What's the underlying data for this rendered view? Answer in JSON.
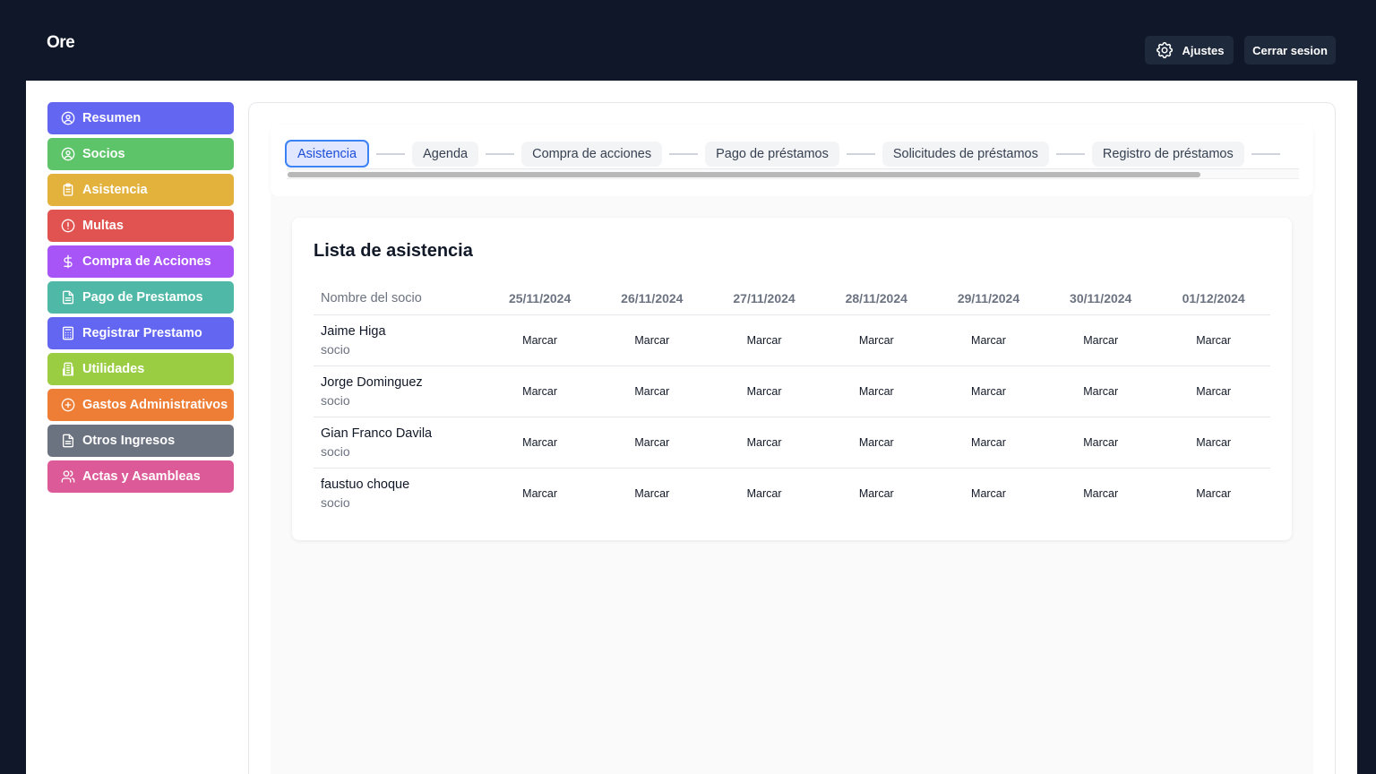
{
  "app": {
    "title": "Ore"
  },
  "header": {
    "settings_label": "Ajustes",
    "logout_label": "Cerrar sesion"
  },
  "sidebar": {
    "items": [
      {
        "label": "Resumen",
        "color": "#6366f1",
        "icon": "user-circle-icon"
      },
      {
        "label": "Socios",
        "color": "#5ec46a",
        "icon": "user-circle-icon"
      },
      {
        "label": "Asistencia",
        "color": "#e3b23c",
        "icon": "clipboard-icon"
      },
      {
        "label": "Multas",
        "color": "#e05350",
        "icon": "alert-circle-icon"
      },
      {
        "label": "Compra de Acciones",
        "color": "#a855f7",
        "icon": "dollar-icon"
      },
      {
        "label": "Pago de Prestamos",
        "color": "#4fb8a6",
        "icon": "document-icon"
      },
      {
        "label": "Registrar Prestamo",
        "color": "#6366f1",
        "icon": "calculator-icon"
      },
      {
        "label": "Utilidades",
        "color": "#9acd42",
        "icon": "building-icon"
      },
      {
        "label": "Gastos Administrativos",
        "color": "#ee7d35",
        "icon": "plus-circle-icon"
      },
      {
        "label": "Otros Ingresos",
        "color": "#6b7280",
        "icon": "document-icon"
      },
      {
        "label": "Actas y Asambleas",
        "color": "#dc5a97",
        "icon": "users-icon"
      }
    ]
  },
  "tabs": [
    {
      "label": "Asistencia",
      "active": true
    },
    {
      "label": "Agenda",
      "active": false
    },
    {
      "label": "Compra de acciones",
      "active": false
    },
    {
      "label": "Pago de préstamos",
      "active": false
    },
    {
      "label": "Solicitudes de préstamos",
      "active": false
    },
    {
      "label": "Registro de préstamos",
      "active": false
    }
  ],
  "attendance": {
    "title": "Lista de asistencia",
    "name_header": "Nombre del socio",
    "dates": [
      "25/11/2024",
      "26/11/2024",
      "27/11/2024",
      "28/11/2024",
      "29/11/2024",
      "30/11/2024",
      "01/12/2024"
    ],
    "mark_label": "Marcar",
    "members": [
      {
        "name": "Jaime Higa",
        "role": "socio"
      },
      {
        "name": "Jorge Dominguez",
        "role": "socio"
      },
      {
        "name": "Gian Franco Davila",
        "role": "socio"
      },
      {
        "name": "faustuo choque",
        "role": "socio"
      }
    ]
  }
}
